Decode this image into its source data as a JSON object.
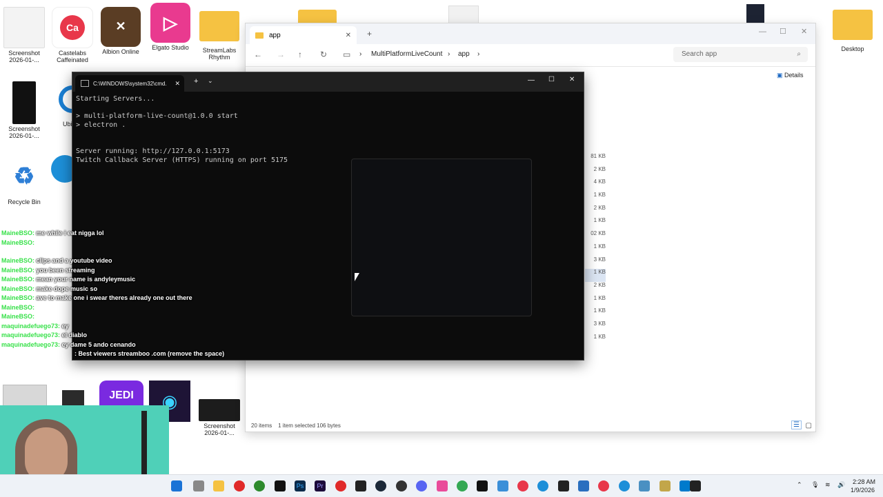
{
  "desktop": {
    "icons": [
      {
        "label": "Screenshot 2026-01-..."
      },
      {
        "label": "Castelabs Caffeinated"
      },
      {
        "label": "Albion Online"
      },
      {
        "label": "Elgato Studio"
      },
      {
        "label": "StreamLabs Rhythm"
      },
      {
        "label": "Screenshot 2026-01-..."
      },
      {
        "label": "Ubisoft"
      },
      {
        "label": "Recycle Bin"
      },
      {
        "label": "Desktop"
      },
      {
        "label": "Screenshot 2026-01-..."
      }
    ]
  },
  "explorer": {
    "tab_title": "app",
    "breadcrumb": [
      "MultiPlatformLiveCount",
      "app"
    ],
    "search_placeholder": "Search app",
    "details_label": "Details",
    "sizes": [
      "81 KB",
      "2 KB",
      "4 KB",
      "1 KB",
      "2 KB",
      "1 KB",
      "02 KB",
      "1 KB",
      "3 KB",
      "1 KB",
      "2 KB",
      "1 KB",
      "1 KB",
      "3 KB",
      "1 KB"
    ],
    "selected_index": 9,
    "status": {
      "items": "20 items",
      "selected": "1 item selected  106 bytes"
    }
  },
  "cmd": {
    "title": "C:\\WINDOWS\\system32\\cmd.",
    "lines": [
      "Starting Servers...",
      "> multi-platform-live-count@1.0.0 start",
      "> electron .",
      "Server running: http://127.0.0.1:5173",
      "Twitch Callback Server (HTTPS) running on port 5175"
    ]
  },
  "chat": [
    {
      "user": "MaineBSO:",
      "msg": "me while i eat nigga lol"
    },
    {
      "user": "MaineBSO:",
      "msg": ""
    },
    {
      "user": "MaineBSO:",
      "msg": "clips and a youtube video"
    },
    {
      "user": "MaineBSO:",
      "msg": "you been streaming"
    },
    {
      "user": "MaineBSO:",
      "msg": "mean your name is andyleymusic"
    },
    {
      "user": "MaineBSO:",
      "msg": "make dope music so"
    },
    {
      "user": "MaineBSO:",
      "msg": "ave to make one i swear theres already one out there"
    },
    {
      "user": "MaineBSO:",
      "msg": ""
    },
    {
      "user": "MaineBSO:",
      "msg": ""
    },
    {
      "user": "maquinadefuego73:",
      "msg": "ey"
    },
    {
      "user": "maquinadefuego73:",
      "msg": "el diablo"
    },
    {
      "user": "maquinadefuego73:",
      "msg": "ey dame 5 ando cenando"
    },
    {
      "user": "",
      "msg": ": Best viewers streamboo .com (remove the space)"
    }
  ],
  "taskbar": {
    "time": "2:28 AM",
    "date": "1/9/2026"
  },
  "colors": {
    "chat_user": "#38e14a",
    "terminal_bg": "#0c0c0c",
    "folder": "#f5c242"
  }
}
